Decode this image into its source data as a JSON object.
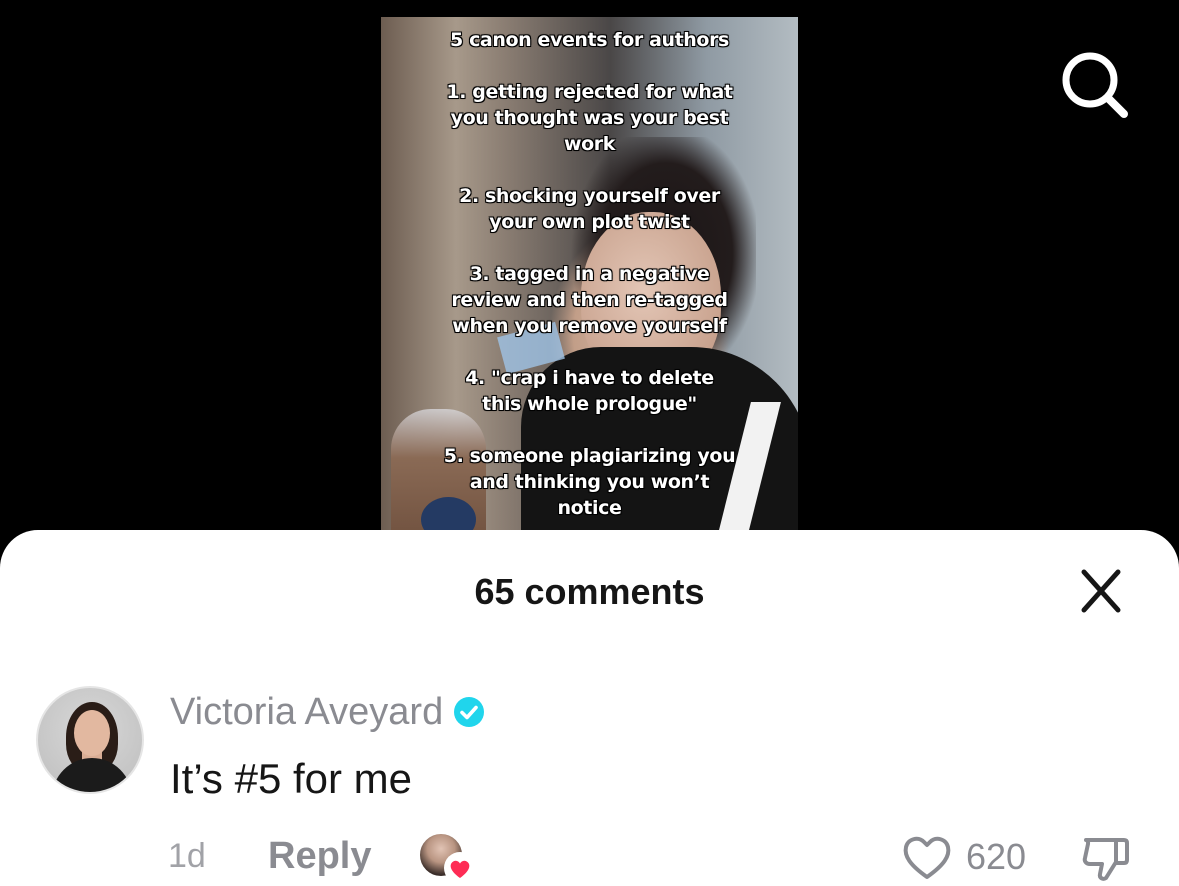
{
  "video": {
    "overlay_lines": [
      "5 canon events for authors",
      "",
      "1. getting rejected for what",
      "you thought was your best",
      "work",
      "",
      "2. shocking yourself over",
      "your own plot twist",
      "",
      "3. tagged in a negative",
      "review and then re-tagged",
      "when you remove yourself",
      "",
      "4. \"crap i have to delete",
      "this whole prologue\"",
      "",
      "5. someone plagiarizing you",
      "and thinking you won’t",
      "notice"
    ]
  },
  "top_bar": {
    "search_icon": "search-icon"
  },
  "comments_sheet": {
    "title": "65 comments",
    "close_icon": "close-icon",
    "comment": {
      "username": "Victoria Aveyard",
      "verified": true,
      "verified_color": "#20D5EC",
      "text": "It’s #5 for me",
      "time": "1d",
      "reply_label": "Reply",
      "creator_liked": true,
      "creator_like_color": "#FE2C55",
      "like_count": "620",
      "like_icon": "heart-outline-icon",
      "dislike_icon": "thumbs-down-icon"
    }
  }
}
